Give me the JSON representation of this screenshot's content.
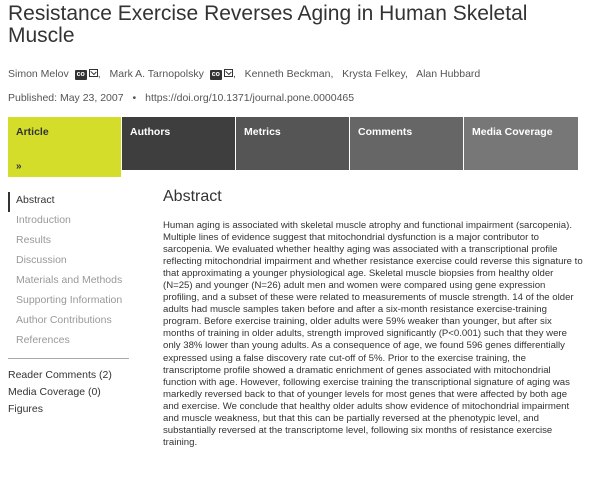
{
  "article": {
    "title": "Resistance Exercise Reverses Aging in Human Skeletal Muscle",
    "authors": [
      {
        "name": "Simon Melov",
        "badge": "co",
        "has_mail": true
      },
      {
        "name": "Mark A. Tarnopolsky",
        "badge": "co",
        "has_mail": true
      },
      {
        "name": "Kenneth Beckman",
        "badge": "",
        "has_mail": false
      },
      {
        "name": "Krysta Felkey",
        "badge": "",
        "has_mail": false
      },
      {
        "name": "Alan Hubbard",
        "badge": "",
        "has_mail": false
      }
    ],
    "published": "Published: May 23, 2007",
    "doi": "https://doi.org/10.1371/journal.pone.0000465"
  },
  "tabs": [
    {
      "label": "Article",
      "active": true
    },
    {
      "label": "Authors",
      "active": false
    },
    {
      "label": "Metrics",
      "active": false
    },
    {
      "label": "Comments",
      "active": false
    },
    {
      "label": "Media Coverage",
      "active": false
    }
  ],
  "tab_chevron": "»",
  "sidenav": {
    "items": [
      "Abstract",
      "Introduction",
      "Results",
      "Discussion",
      "Materials and Methods",
      "Supporting Information",
      "Author Contributions",
      "References"
    ],
    "links": [
      "Reader Comments (2)",
      "Media Coverage (0)",
      "Figures"
    ]
  },
  "abstract": {
    "heading": "Abstract",
    "text": "Human aging is associated with skeletal muscle atrophy and functional impairment (sarcopenia). Multiple lines of evidence suggest that mitochondrial dysfunction is a major contributor to sarcopenia. We evaluated whether healthy aging was associated with a transcriptional profile reflecting mitochondrial impairment and whether resistance exercise could reverse this signature to that approximating a younger physiological age. Skeletal muscle biopsies from healthy older (N=25) and younger (N=26) adult men and women were compared using gene expression profiling, and a subset of these were related to measurements of muscle strength. 14 of the older adults had muscle samples taken before and after a six-month resistance exercise-training program. Before exercise training, older adults were 59% weaker than younger, but after six months of training in older adults, strength improved significantly (P<0.001) such that they were only 38% lower than young adults. As a consequence of age, we found 596 genes differentially expressed using a false discovery rate cut-off of 5%. Prior to the exercise training, the transcriptome profile showed a dramatic enrichment of genes associated with mitochondrial function with age. However, following exercise training the transcriptional signature of aging was markedly reversed back to that of younger levels for most genes that were affected by both age and exercise. We conclude that healthy older adults show evidence of mitochondrial impairment and muscle weakness, but that this can be partially reversed at the phenotypic level, and substantially reversed at the transcriptome level, following six months of resistance exercise training."
  },
  "colors": {
    "active_tab": "#d4dd2a",
    "tab_dark": "#3c3c3c",
    "text": "#333333",
    "muted": "#999999"
  }
}
